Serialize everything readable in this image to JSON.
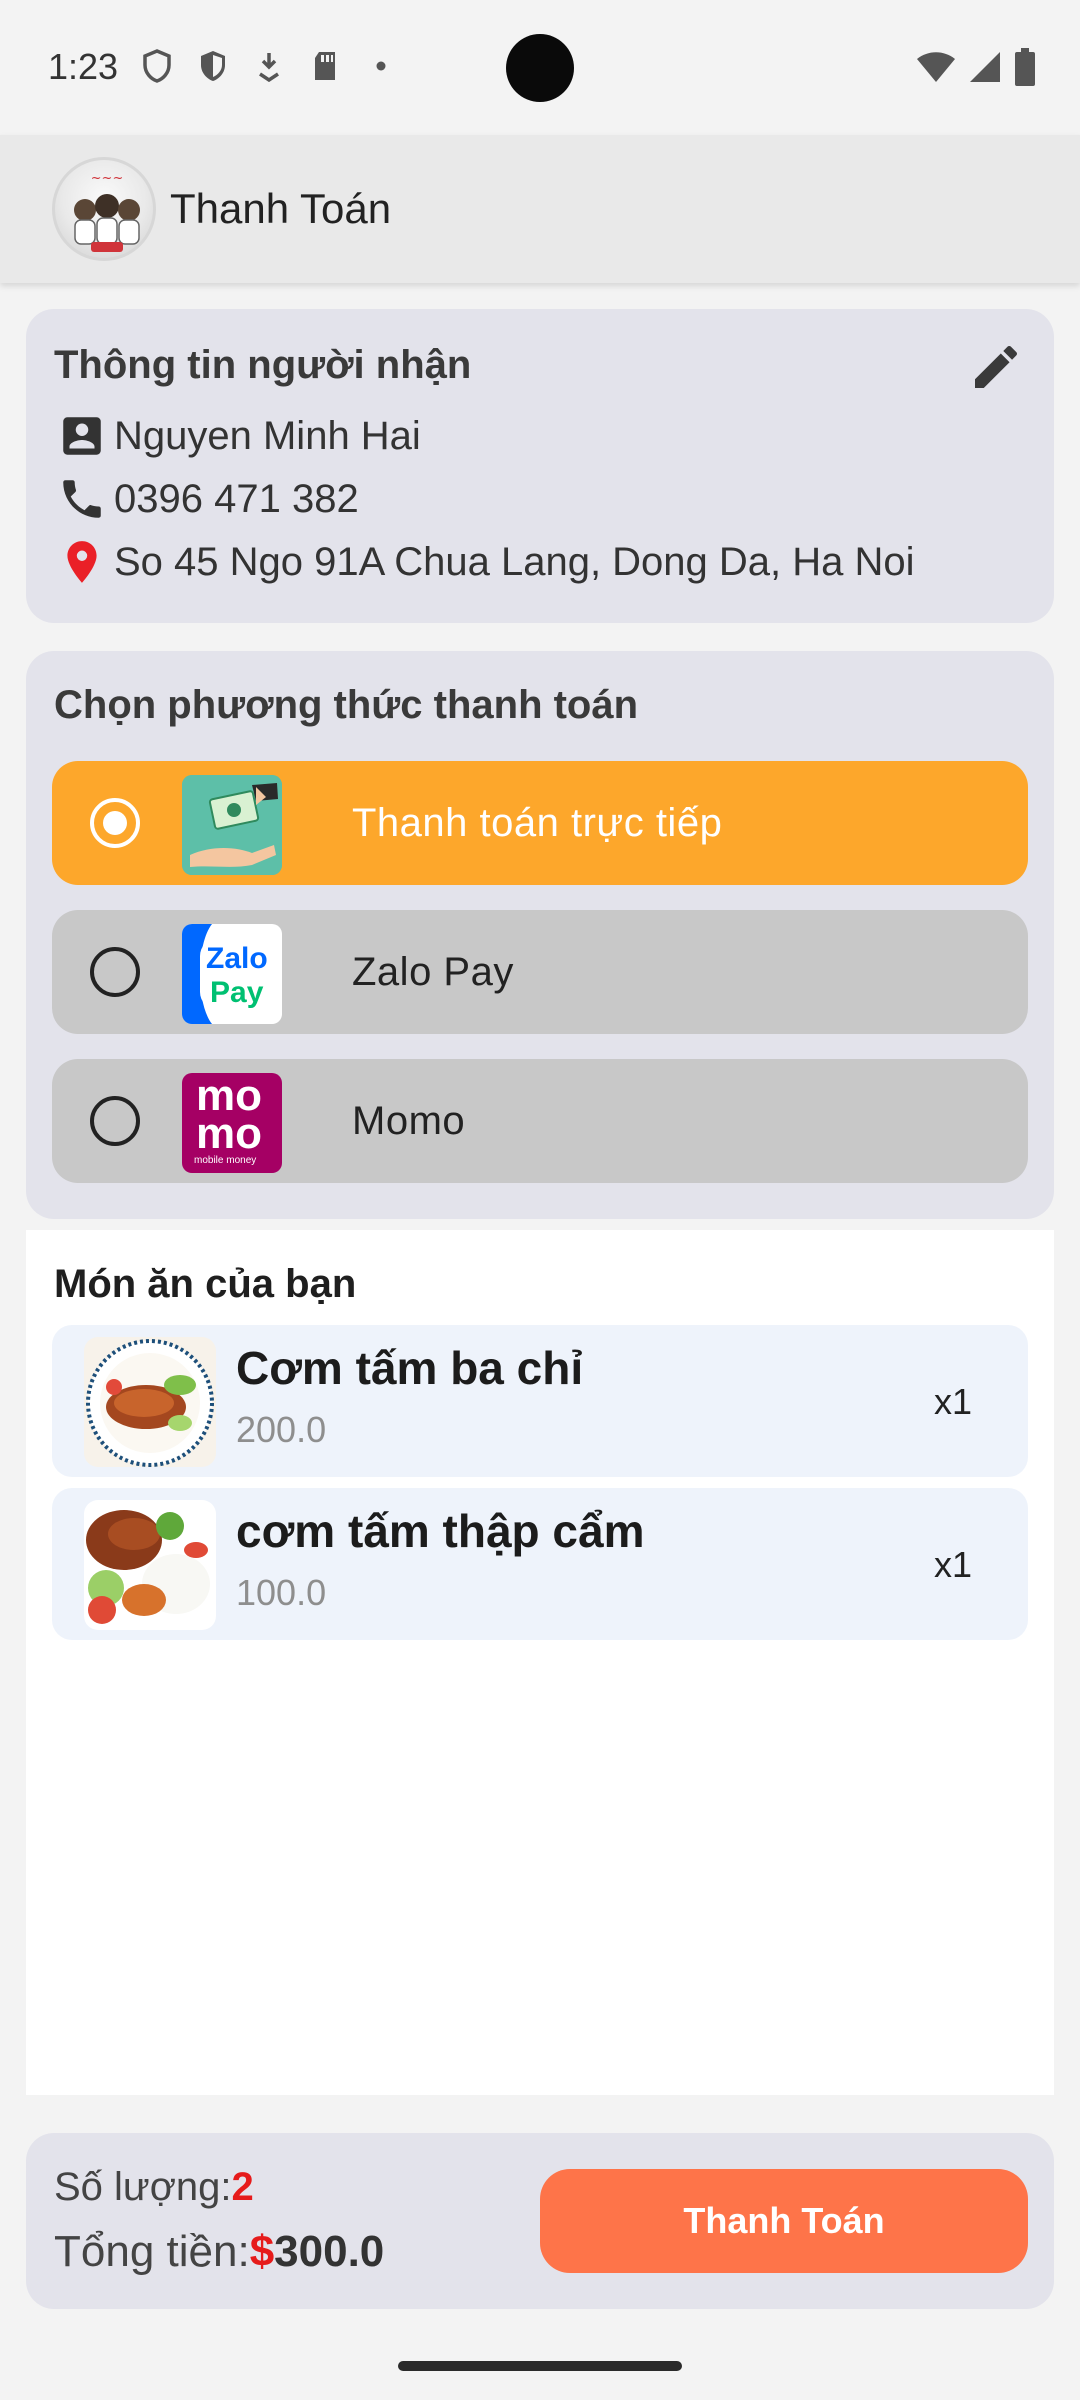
{
  "status_bar": {
    "time": "1:23",
    "icons": [
      "shield-outline-icon",
      "shield-filled-icon",
      "download-icon",
      "sd-card-icon",
      "dot-icon"
    ],
    "right_icons": [
      "wifi-icon",
      "signal-icon",
      "battery-icon"
    ]
  },
  "app_bar": {
    "title": "Thanh Toán",
    "logo": "restaurant-logo"
  },
  "recipient": {
    "title": "Thông tin người nhận",
    "name": "Nguyen Minh Hai",
    "phone": "0396 471 382",
    "address": "So 45 Ngo 91A Chua Lang, Dong Da, Ha Noi"
  },
  "payment": {
    "title": "Chọn phương thức thanh toán",
    "options": [
      {
        "label": "Thanh toán trực tiếp",
        "selected": true,
        "icon": "cash-hand-icon"
      },
      {
        "label": "Zalo Pay",
        "selected": false,
        "icon": "zalopay-logo"
      },
      {
        "label": "Momo",
        "selected": false,
        "icon": "momo-logo"
      }
    ],
    "zalo_logo_text": [
      "Zalo",
      "Pay"
    ],
    "momo_logo_text": [
      "mo",
      "mo",
      "mobile money"
    ]
  },
  "food": {
    "heading": "Món ăn của bạn",
    "items": [
      {
        "name": "Cơm tấm ba chỉ",
        "price": "200.0",
        "qty": "x1"
      },
      {
        "name": "cơm tấm thập cẩm",
        "price": "100.0",
        "qty": "x1"
      }
    ]
  },
  "summary": {
    "qty_label": "Số lượng:",
    "qty_value": "2",
    "total_label": "Tổng tiền:",
    "currency": "$",
    "total_value": "300.0",
    "button_label": "Thanh Toán"
  },
  "colors": {
    "selected_option": "#fda72b",
    "button": "#fe7449",
    "accent_red": "#e61b1b",
    "card_bg": "#e3e3eb"
  }
}
